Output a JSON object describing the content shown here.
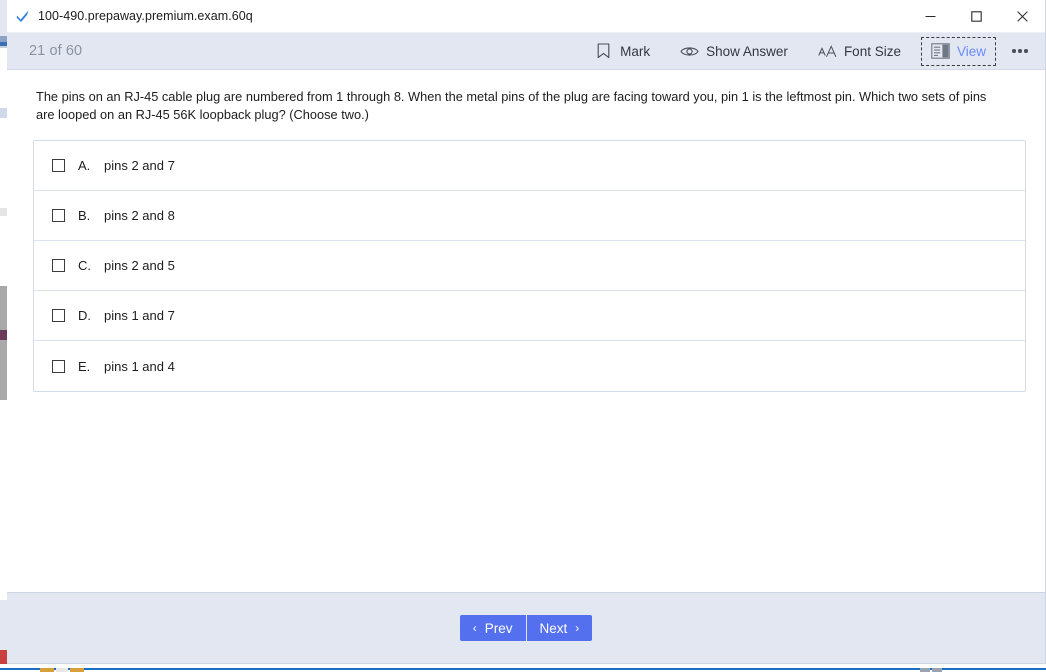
{
  "window": {
    "title": "100-490.prepaway.premium.exam.60q",
    "app_icon": "blue-checkmark-icon",
    "controls": {
      "minimize": "—",
      "maximize": "☐",
      "close": "✕"
    }
  },
  "toolbar": {
    "counter": "21 of 60",
    "items": [
      {
        "label": "Mark",
        "icon": "bookmark-icon",
        "focused": false
      },
      {
        "label": "Show Answer",
        "icon": "eye-icon",
        "focused": false
      },
      {
        "label": "Font Size",
        "icon": "font-size-icon",
        "focused": false
      },
      {
        "label": "View",
        "icon": "view-layout-icon",
        "focused": true
      }
    ],
    "overflow_label": "more-options"
  },
  "question": {
    "text": "The pins on an RJ-45 cable plug are numbered from 1 through 8. When the metal pins of the plug are facing toward you, pin 1 is the leftmost pin. Which two sets of pins are looped on an RJ-45 56K loopback plug? (Choose two.)"
  },
  "options": [
    {
      "letter": "A.",
      "text": "pins 2 and 7",
      "checked": false
    },
    {
      "letter": "B.",
      "text": "pins 2 and 8",
      "checked": false
    },
    {
      "letter": "C.",
      "text": "pins 2 and 5",
      "checked": false
    },
    {
      "letter": "D.",
      "text": "pins 1 and 7",
      "checked": false
    },
    {
      "letter": "E.",
      "text": "pins 1 and 4",
      "checked": false
    }
  ],
  "footer": {
    "prev_label": "Prev",
    "next_label": "Next",
    "prev_chevron": "‹",
    "next_chevron": "›"
  },
  "colors": {
    "toolbar_bg": "#e3e7f2",
    "accent_blue": "#5570ee",
    "view_active_text": "#6b8afd",
    "counter_text": "#8c93a3",
    "panel_border": "#d5dbe8"
  }
}
